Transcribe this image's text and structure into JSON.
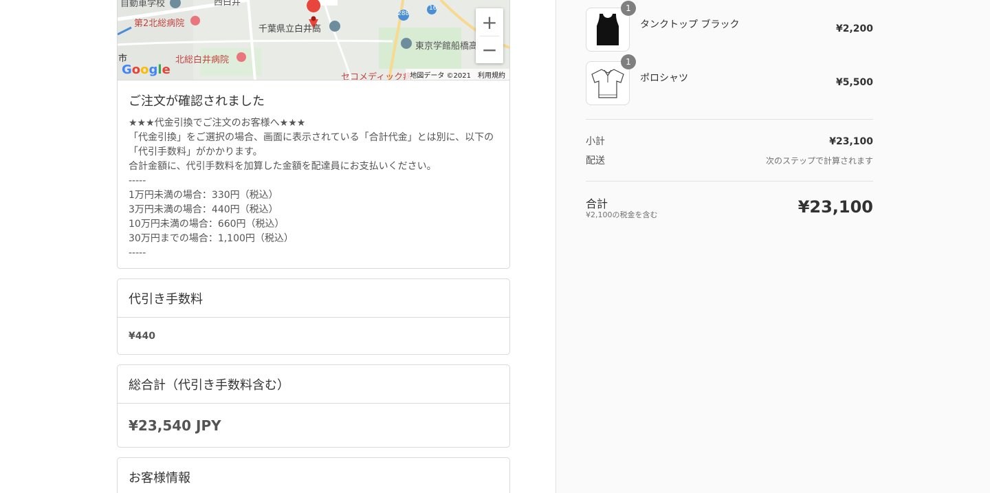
{
  "map": {
    "labels": {
      "school_top": "自動車学校",
      "hospital_2": "第2北総病院",
      "nishi": "西白井",
      "station_mark": "■",
      "highschool": "千葉県立白井高",
      "route": "288",
      "route2": "16",
      "tokyo": "東京学館船橋高",
      "shi": "市",
      "hospital_hokuso": "北総白井病院",
      "secom": "セコメディック病",
      "google": "Google"
    },
    "attribution": "地図データ ©2021",
    "terms": "利用規約",
    "zoom_in": "+",
    "zoom_out": "−"
  },
  "confirm": {
    "title": "ご注文が確認されました",
    "lines": [
      "★★★代金引換でご注文のお客様へ★★★",
      "「代金引換」をご選択の場合、画面に表示されている「合計代金」とは別に、以下の",
      "「代引手数料」がかかります。",
      "合計金額に、代引手数料を加算した金額を配達員にお支払いください。",
      "-----",
      "1万円未満の場合：330円（税込）",
      "3万円未満の場合：440円（税込）",
      "10万円未満の場合：660円（税込）",
      "30万円までの場合：1,100円（税込）",
      "-----"
    ]
  },
  "fee": {
    "title": "代引き手数料",
    "value": "¥440"
  },
  "total": {
    "title": "総合計（代引き手数料含む）",
    "value": "¥23,540 JPY"
  },
  "customer": {
    "title": "お客様情報"
  },
  "summary": {
    "items": [
      {
        "name": "タンクトップ ブラック",
        "qty": "1",
        "price": "¥2,200",
        "icon": "tank-top-icon"
      },
      {
        "name": "ポロシャツ",
        "qty": "1",
        "price": "¥5,500",
        "icon": "polo-shirt-icon"
      }
    ],
    "subtotal_label": "小計",
    "subtotal_value": "¥23,100",
    "shipping_label": "配送",
    "shipping_value": "次のステップで計算されます",
    "total_label": "合計",
    "tax_note": "¥2,100の税金を含む",
    "total_value": "¥23,100"
  }
}
